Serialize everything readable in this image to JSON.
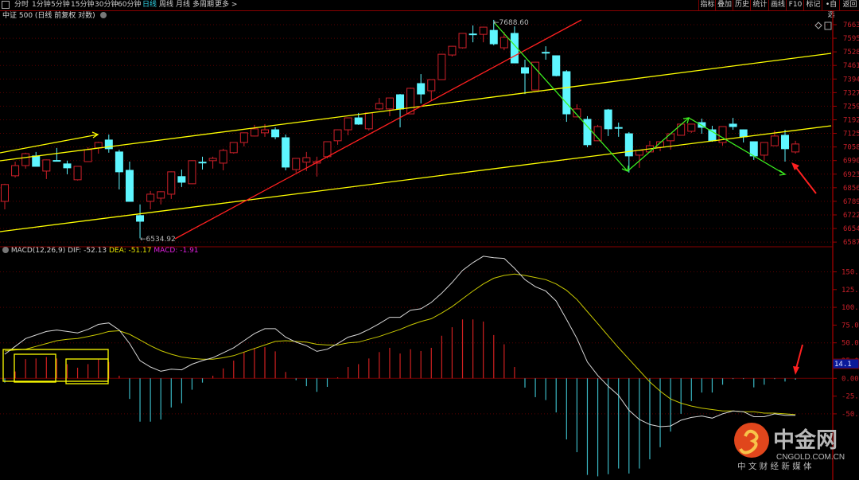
{
  "toolbar": {
    "tabs": [
      "分时",
      "1分钟",
      "5分钟",
      "15分钟",
      "30分钟",
      "60分钟",
      "日线",
      "周线",
      "月线",
      "多周期",
      "更多 >"
    ],
    "active_tab": "日线",
    "right_buttons": [
      "指标",
      "叠加",
      "历史",
      "统计",
      "画线",
      "F10",
      "标记",
      "•自选",
      "返回"
    ]
  },
  "title": "中证 500 (日线 前复权 对数)",
  "macd": {
    "name": "MACD(12,26,9)",
    "dif_label": "DIF: -52.13",
    "dea_label": "DEA: -51.17",
    "macd_label": "MACD: -1.91",
    "current_marker": "14.1"
  },
  "annotations": {
    "high_label": "7688.60",
    "low_label": "6534.92"
  },
  "logo": {
    "name": "中金网",
    "domain": "CNGOLD.COM.CN",
    "slogan": "中 文 财 经 新 媒 体"
  },
  "colors": {
    "up": "#d0202a",
    "down": "#5ef6ff",
    "dif": "#d8d8d8",
    "dea": "#c8c800",
    "channel": "#ffff00",
    "trend_red": "#ff2020",
    "zigzag": "#3cf020"
  },
  "chart_data": [
    {
      "type": "candlestick",
      "title": "中证 500 (日线 前复权 对数)",
      "y_ticks": [
        7663,
        7595,
        7528,
        7461,
        7394,
        7327,
        7259,
        7192,
        7125,
        7058,
        6990,
        6923,
        6856,
        6789,
        6722,
        6654,
        6587
      ],
      "ylim": [
        6587,
        7663
      ],
      "ohlc": [
        [
          6730,
          6823,
          6688,
          6819
        ],
        [
          6865,
          6940,
          6856,
          6919
        ],
        [
          6919,
          6987,
          6903,
          6982
        ],
        [
          6970,
          6991,
          6915,
          6915
        ],
        [
          6890,
          6951,
          6848,
          6949
        ],
        [
          6946,
          7012,
          6940,
          6944
        ],
        [
          6928,
          6945,
          6873,
          6907
        ],
        [
          6844,
          6917,
          6840,
          6915
        ],
        [
          6940,
          7016,
          6938,
          7003
        ],
        [
          7012,
          7045,
          6982,
          7041
        ],
        [
          7054,
          7083,
          6987,
          7008
        ],
        [
          6991,
          7003,
          6793,
          6886
        ],
        [
          6894,
          6940,
          6728,
          6730
        ],
        [
          6655,
          6714,
          6534.92,
          6625
        ],
        [
          6730,
          6785,
          6688,
          6768
        ],
        [
          6747,
          6783,
          6714,
          6781
        ],
        [
          6768,
          6888,
          6743,
          6886
        ],
        [
          6861,
          6898,
          6806,
          6831
        ],
        [
          6823,
          6947,
          6821,
          6945
        ],
        [
          6937,
          6966,
          6898,
          6935
        ],
        [
          6945,
          6966,
          6903,
          6957
        ],
        [
          6932,
          7008,
          6894,
          6999
        ],
        [
          6987,
          7043,
          6982,
          7041
        ],
        [
          7041,
          7094,
          7020,
          7092
        ],
        [
          7075,
          7134,
          7073,
          7113
        ],
        [
          7092,
          7138,
          7071,
          7108
        ],
        [
          7108,
          7121,
          7058,
          7071
        ],
        [
          7066,
          7083,
          6894,
          6911
        ],
        [
          6898,
          6959,
          6882,
          6957
        ],
        [
          6937,
          6991,
          6890,
          6961
        ],
        [
          6932,
          6966,
          6861,
          6940
        ],
        [
          6966,
          7047,
          6957,
          7045
        ],
        [
          7050,
          7110,
          7029,
          7108
        ],
        [
          7108,
          7173,
          7079,
          7171
        ],
        [
          7171,
          7197,
          7134,
          7138
        ],
        [
          7113,
          7199,
          7104,
          7197
        ],
        [
          7218,
          7276,
          7213,
          7247
        ],
        [
          7218,
          7278,
          7180,
          7276
        ],
        [
          7293,
          7297,
          7121,
          7218
        ],
        [
          7192,
          7330,
          7190,
          7327
        ],
        [
          7352,
          7402,
          7247,
          7297
        ],
        [
          7314,
          7375,
          7260,
          7373
        ],
        [
          7373,
          7509,
          7371,
          7507
        ],
        [
          7503,
          7551,
          7495,
          7549
        ],
        [
          7541,
          7619,
          7537,
          7617
        ],
        [
          7614,
          7659,
          7570,
          7612
        ],
        [
          7612,
          7652,
          7570,
          7650
        ],
        [
          7633,
          7688.6,
          7554,
          7562
        ],
        [
          7541,
          7625,
          7528,
          7596
        ],
        [
          7617,
          7654,
          7459,
          7461
        ],
        [
          7436,
          7478,
          7297,
          7407
        ],
        [
          7318,
          7467,
          7316,
          7465
        ],
        [
          7517,
          7549,
          7478,
          7515
        ],
        [
          7499,
          7501,
          7390,
          7394
        ],
        [
          7415,
          7423,
          7150,
          7192
        ],
        [
          7176,
          7243,
          7174,
          7218
        ],
        [
          7163,
          7180,
          7016,
          7029
        ],
        [
          7050,
          7134,
          7048,
          7125
        ],
        [
          7213,
          7218,
          7075,
          7113
        ],
        [
          7120,
          7146,
          7071,
          7117
        ],
        [
          7087,
          7096,
          6882,
          6970
        ],
        [
          6974,
          7001,
          6907,
          6999
        ],
        [
          6991,
          7050,
          6989,
          7024
        ],
        [
          7016,
          7047,
          6995,
          7045
        ],
        [
          7050,
          7089,
          7003,
          7087
        ],
        [
          7079,
          7140,
          7077,
          7138
        ],
        [
          7100,
          7140,
          7092,
          7138
        ],
        [
          7146,
          7167,
          7087,
          7121
        ],
        [
          7108,
          7129,
          7045,
          7050
        ],
        [
          7041,
          7127,
          7024,
          7125
        ],
        [
          7138,
          7171,
          7108,
          7125
        ],
        [
          7108,
          7110,
          7041,
          7071
        ],
        [
          7045,
          7047,
          6949,
          6970
        ],
        [
          6974,
          7043,
          6945,
          7041
        ],
        [
          7024,
          7104,
          7022,
          7075
        ],
        [
          7079,
          7108,
          6940,
          7008
        ],
        [
          6991,
          7050,
          6982,
          7033
        ]
      ],
      "high_mark": 7688.6,
      "low_mark": 6534.92
    },
    {
      "type": "macd",
      "title": "MACD(12,26,9)",
      "y_ticks": [
        "150.0",
        "125.0",
        "100.0",
        "75.00",
        "50.00",
        "25.00",
        "0.00",
        "-25.00",
        "-50.00"
      ],
      "ylim": [
        -150,
        160
      ],
      "series": [
        {
          "name": "DIF",
          "values": [
            34,
            45,
            56,
            61,
            66,
            68,
            66,
            64,
            69,
            76,
            78,
            68,
            49,
            25,
            16,
            10,
            13,
            12,
            20,
            25,
            29,
            36,
            43,
            53,
            63,
            70,
            70,
            58,
            51,
            46,
            38,
            41,
            49,
            58,
            62,
            69,
            77,
            86,
            86,
            96,
            98,
            107,
            120,
            135,
            152,
            163,
            172,
            170,
            169,
            155,
            139,
            129,
            123,
            109,
            83,
            56,
            23,
            4,
            -11,
            -24,
            -45,
            -58,
            -65,
            -68,
            -67,
            -59,
            -55,
            -53,
            -56,
            -50,
            -46,
            -47,
            -54,
            -54,
            -50,
            -52,
            -52.13
          ]
        },
        {
          "name": "DEA",
          "values": [
            38.5,
            40,
            41,
            45,
            49,
            53,
            55,
            56,
            59,
            62,
            66,
            67,
            62,
            54,
            46,
            39,
            34,
            30,
            28,
            27,
            27,
            29,
            32,
            37,
            42,
            47,
            52,
            53,
            52,
            51,
            48,
            47,
            47,
            50,
            51,
            55,
            59,
            64,
            69,
            75,
            80,
            84,
            92,
            101,
            112,
            123,
            133,
            141,
            145,
            147,
            145,
            142,
            139,
            133,
            124,
            111,
            94,
            77,
            60,
            43,
            27,
            11,
            -5,
            -18,
            -29,
            -35,
            -39,
            -42,
            -44,
            -46,
            -46,
            -47,
            -47,
            -49,
            -49,
            -50,
            -51.17
          ]
        },
        {
          "name": "MACD",
          "values": [
            -6,
            9.7,
            27,
            28,
            30,
            28,
            20,
            15,
            20,
            26.5,
            23,
            3.7,
            -29,
            -61,
            -61,
            -58,
            -41,
            -35,
            -16,
            -6,
            3.7,
            14,
            25,
            37,
            43,
            44,
            38,
            9,
            -2.6,
            -11,
            -19,
            -12,
            1.5,
            16,
            20,
            28,
            37,
            43,
            35,
            41,
            38.5,
            43,
            60,
            72,
            83,
            83,
            80,
            61,
            48,
            16,
            -13,
            -26.5,
            -30.6,
            -48,
            -86,
            -104,
            -136,
            -138,
            -135,
            -127,
            -134,
            -127,
            -114,
            -97,
            -75,
            -50,
            -32,
            -20,
            -20,
            -9,
            -1,
            -1,
            -12.7,
            -9,
            -1,
            -4.5,
            -1.91
          ]
        }
      ]
    }
  ]
}
